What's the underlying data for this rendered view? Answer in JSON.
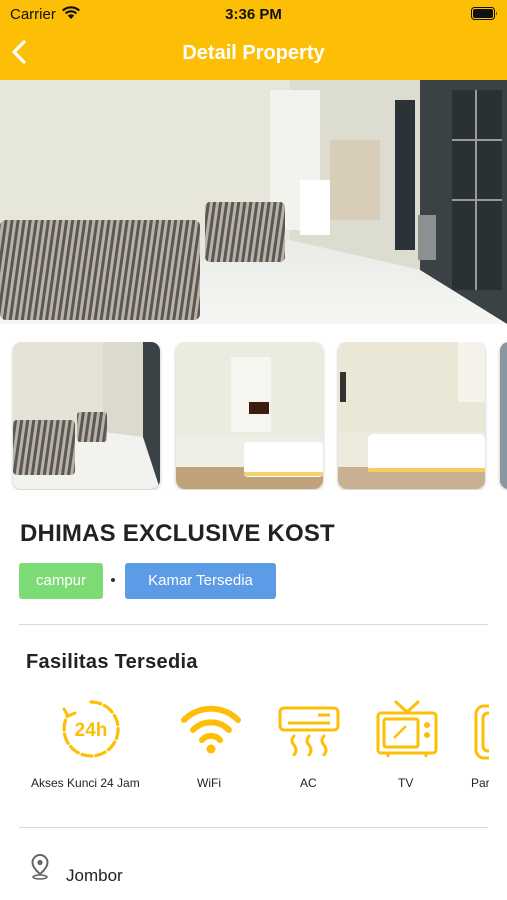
{
  "status_bar": {
    "carrier": "Carrier",
    "time": "3:36 PM"
  },
  "header": {
    "title": "Detail Property"
  },
  "property": {
    "name": "DHIMAS EXCLUSIVE KOST",
    "type_badge": "campur",
    "availability_badge": "Kamar Tersedia"
  },
  "facilities": {
    "title": "Fasilitas Tersedia",
    "items": [
      {
        "label": "Akses Kunci 24 Jam",
        "icon": "clock-24h-icon"
      },
      {
        "label": "WiFi",
        "icon": "wifi-icon"
      },
      {
        "label": "AC",
        "icon": "air-conditioner-icon"
      },
      {
        "label": "TV",
        "icon": "tv-icon"
      },
      {
        "label": "Par",
        "icon": "parking-icon"
      }
    ]
  },
  "location": {
    "text": "Jombor"
  },
  "colors": {
    "accent": "#FDBF06",
    "green_badge": "#7DDB76",
    "blue_badge": "#5C9BE5"
  }
}
